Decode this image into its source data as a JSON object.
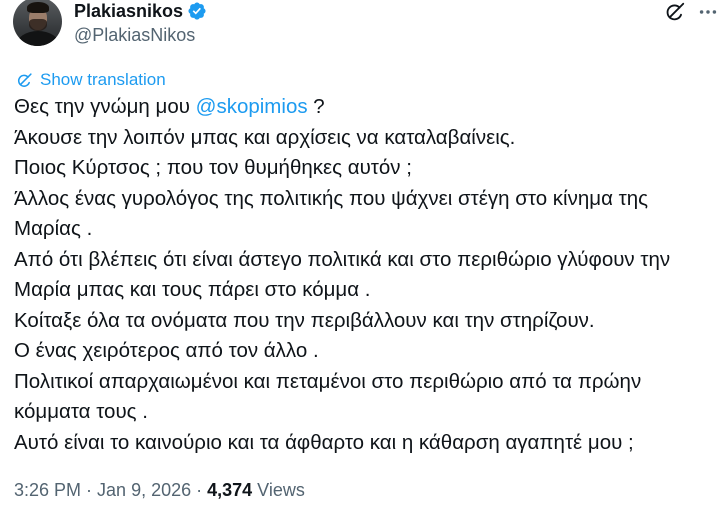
{
  "author": {
    "display_name": "Plakiasnikos",
    "handle": "@PlakiasNikos",
    "verified": true
  },
  "icons": {
    "verified": "verified-badge-icon",
    "grok": "grok-icon",
    "more": "more-options-icon",
    "translate": "translate-icon"
  },
  "translation": {
    "label": "Show translation"
  },
  "tweet": {
    "first_line": {
      "before": "Θες την γνώμη μου ",
      "mention": "@skopimios",
      "after": " ?"
    },
    "lines": [
      "Άκουσε την λοιπόν μπας και αρχίσεις να καταλαβαίνεις.",
      "Ποιος Κύρτσος ; που τον θυμήθηκες αυτόν ;",
      "Άλλος ένας γυρολόγος της πολιτικής που ψάχνει στέγη στο κίνημα της",
      "Μαρίας .",
      "Από ότι βλέπεις ότι είναι άστεγο πολιτικά και στο περιθώριο γλύφουν την",
      "Μαρία μπας και τους πάρει στο κόμμα .",
      "Κοίταξε όλα τα ονόματα που την περιβάλλουν και την στηρίζουν.",
      "Ο ένας χειρότερος από τον άλλο .",
      "Πολιτικοί απαρχαιωμένοι και πεταμένοι στο περιθώριο από τα πρώην",
      "κόμματα τους .",
      "Αυτό είναι το καινούριο και τα άφθαρτο και η κάθαρση αγαπητέ μου ;"
    ]
  },
  "meta": {
    "time": "3:26 PM",
    "separator": "·",
    "date": "Jan 9, 2026",
    "views_count": "4,374",
    "views_label": "Views"
  },
  "colors": {
    "text": "#0f1419",
    "secondary": "#536471",
    "accent": "#1d9bf0",
    "background": "#ffffff"
  }
}
